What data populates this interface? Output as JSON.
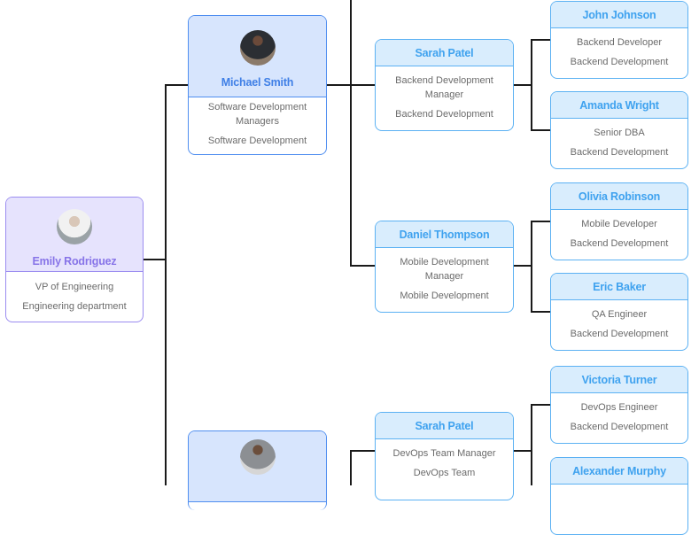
{
  "root": {
    "name": "Emily Rodriguez",
    "title": "VP of Engineering",
    "department": "Engineering department",
    "avatar": "person-photo-icon"
  },
  "managers": [
    {
      "name": "Michael Smith",
      "title_line1": "Software Development",
      "title_line2": "Managers",
      "department": "Software Development",
      "avatar": "person-photo-icon"
    },
    {
      "name": "",
      "avatar": "person-photo-icon"
    }
  ],
  "team_leads": [
    {
      "name": "Sarah Patel",
      "title_line1": "Backend Development",
      "title_line2": "Manager",
      "department": "Backend Development"
    },
    {
      "name": "Daniel Thompson",
      "title_line1": "Mobile Development",
      "title_line2": "Manager",
      "department": "Mobile Development"
    },
    {
      "name": "Sarah Patel",
      "title_line1": "DevOps Team Manager",
      "title_line2": "",
      "department": "DevOps Team"
    }
  ],
  "members": [
    {
      "name": "John Johnson",
      "title": "Backend Developer",
      "department": "Backend Development"
    },
    {
      "name": "Amanda Wright",
      "title": "Senior DBA",
      "department": "Backend Development"
    },
    {
      "name": "Olivia Robinson",
      "title": "Mobile Developer",
      "department": "Backend Development"
    },
    {
      "name": "Eric Baker",
      "title": "QA Engineer",
      "department": "Backend Development"
    },
    {
      "name": "Victoria Turner",
      "title": "DevOps Engineer",
      "department": "Backend Development"
    },
    {
      "name": "Alexander Murphy",
      "title": "",
      "department": ""
    }
  ],
  "colors": {
    "root_border": "#9b8cf0",
    "root_fill": "#e6e3fd",
    "manager_border": "#4f8ef0",
    "manager_fill": "#d7e5fd",
    "member_border": "#5bb1f3",
    "member_fill": "#d9edfd",
    "connector": "#1a1a1a"
  }
}
